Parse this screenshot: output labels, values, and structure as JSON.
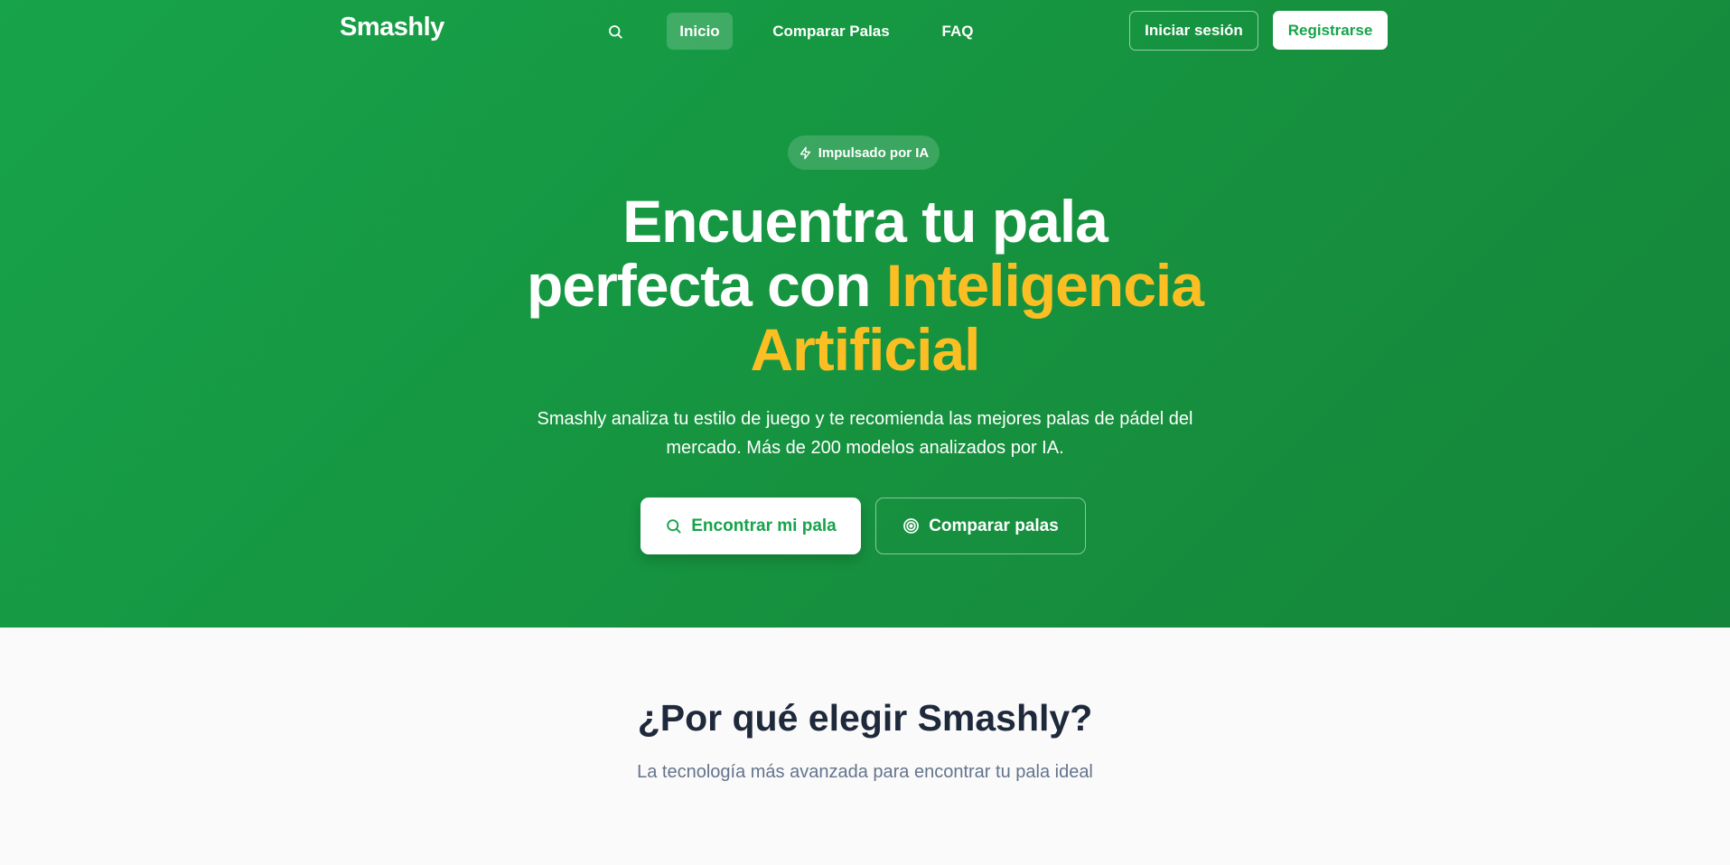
{
  "colors": {
    "brand_green": "#17a34a",
    "accent_yellow": "#fbbf24",
    "heading_dark": "#1e293b",
    "muted_text": "#64748b"
  },
  "nav": {
    "logo": "Smashly",
    "search_icon": "search-icon",
    "links": [
      {
        "label": "Inicio",
        "active": true
      },
      {
        "label": "Comparar Palas",
        "active": false
      },
      {
        "label": "FAQ",
        "active": false
      }
    ],
    "login_label": "Iniciar sesión",
    "register_label": "Registrarse"
  },
  "hero": {
    "badge_icon": "lightning-icon",
    "badge_label": "Impulsado por IA",
    "headline_line1": "Encuentra tu pala",
    "headline_line2_plain": "perfecta con ",
    "headline_line2_accent": "Inteligencia",
    "headline_line3_accent": "Artificial",
    "subtitle": "Smashly analiza tu estilo de juego y te recomienda las mejores palas de pádel del mercado. Más de 200 modelos analizados por IA.",
    "primary_button": {
      "icon": "search-icon",
      "label": "Encontrar mi pala"
    },
    "secondary_button": {
      "icon": "target-icon",
      "label": "Comparar palas"
    }
  },
  "why": {
    "title": "¿Por qué elegir Smashly?",
    "subtitle": "La tecnología más avanzada para encontrar tu pala ideal"
  }
}
